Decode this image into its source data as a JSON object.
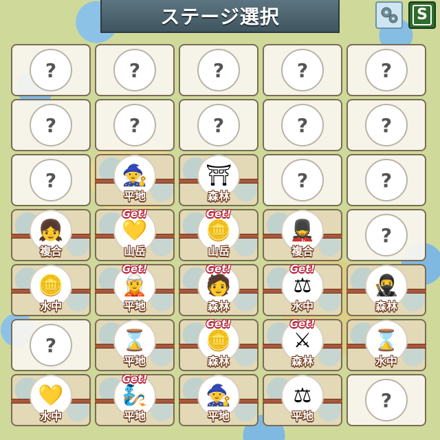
{
  "header": {
    "title": "ステージ選択"
  },
  "buttons": {
    "settings_icon": "gear-icon",
    "shop_label": "S"
  },
  "colors": {
    "get_red": "#b3122a",
    "terrain_outline": "#6b3316",
    "title_bg": "#4a606b"
  },
  "stages": [
    [
      {
        "status": "locked",
        "label": "?"
      },
      {
        "status": "locked",
        "label": "?"
      },
      {
        "status": "locked",
        "label": "?"
      },
      {
        "status": "locked",
        "label": "?"
      },
      {
        "status": "locked",
        "label": "?"
      }
    ],
    [
      {
        "status": "locked",
        "label": "?"
      },
      {
        "status": "locked",
        "label": "?"
      },
      {
        "status": "locked",
        "label": "?"
      },
      {
        "status": "locked",
        "label": "?"
      },
      {
        "status": "locked",
        "label": "?"
      }
    ],
    [
      {
        "status": "locked",
        "label": "?"
      },
      {
        "status": "cleared",
        "character": "mage-character-icon",
        "glyph": "🧙",
        "terrain": "平地",
        "get": ""
      },
      {
        "status": "cleared",
        "character": "samurai-helmet-character-icon",
        "glyph": "⛩",
        "terrain": "森林",
        "get": ""
      },
      {
        "status": "locked",
        "label": "?"
      },
      {
        "status": "locked",
        "label": "?"
      }
    ],
    [
      {
        "status": "cleared",
        "character": "staff-girl-character-icon",
        "glyph": "👧",
        "terrain": "複合",
        "get": ""
      },
      {
        "status": "cleared",
        "character": "gold-gem-icon",
        "glyph": "💛",
        "terrain": "山岳",
        "get": "Get!"
      },
      {
        "status": "cleared",
        "character": "gold-coins-icon",
        "glyph": "🪙",
        "terrain": "山岳",
        "get": "Get!"
      },
      {
        "status": "cleared",
        "character": "cannon-soldier-character-icon",
        "glyph": "💂",
        "terrain": "複合",
        "get": ""
      },
      {
        "status": "locked",
        "label": "?"
      }
    ],
    [
      {
        "status": "cleared",
        "character": "gold-coins-icon",
        "glyph": "🪙",
        "terrain": "水中",
        "get": ""
      },
      {
        "status": "cleared",
        "character": "dark-mage-character-icon",
        "glyph": "🧝",
        "terrain": "平地",
        "get": "Get!"
      },
      {
        "status": "cleared",
        "character": "gunner-character-icon",
        "glyph": "🧑",
        "terrain": "森林",
        "get": "Get!"
      },
      {
        "status": "cleared",
        "character": "gold-scales-icon",
        "glyph": "⚖",
        "terrain": "水中",
        "get": "Get!"
      },
      {
        "status": "cleared",
        "character": "scythe-warrior-character-icon",
        "glyph": "🥷",
        "terrain": "森林",
        "get": ""
      }
    ],
    [
      {
        "status": "locked",
        "label": "?"
      },
      {
        "status": "cleared",
        "character": "hourglass-icon",
        "glyph": "⌛",
        "terrain": "平地",
        "get": ""
      },
      {
        "status": "cleared",
        "character": "gold-coins-icon",
        "glyph": "🪙",
        "terrain": "森林",
        "get": "Get!"
      },
      {
        "status": "cleared",
        "character": "knight-character-icon",
        "glyph": "⚔",
        "terrain": "森林",
        "get": "Get!"
      },
      {
        "status": "cleared",
        "character": "hourglass-icon",
        "glyph": "⌛",
        "terrain": "水中",
        "get": ""
      }
    ],
    [
      {
        "status": "cleared",
        "character": "gold-gem-icon",
        "glyph": "💛",
        "terrain": "水中",
        "get": ""
      },
      {
        "status": "cleared",
        "character": "blue-face-character-icon",
        "glyph": "🧞",
        "terrain": "平地",
        "get": "Get!"
      },
      {
        "status": "cleared",
        "character": "witch-character-icon",
        "glyph": "🧙",
        "terrain": "平地",
        "get": ""
      },
      {
        "status": "cleared",
        "character": "gold-scales-icon",
        "glyph": "⚖",
        "terrain": "平地",
        "get": ""
      },
      {
        "status": "locked",
        "label": "?"
      }
    ]
  ]
}
